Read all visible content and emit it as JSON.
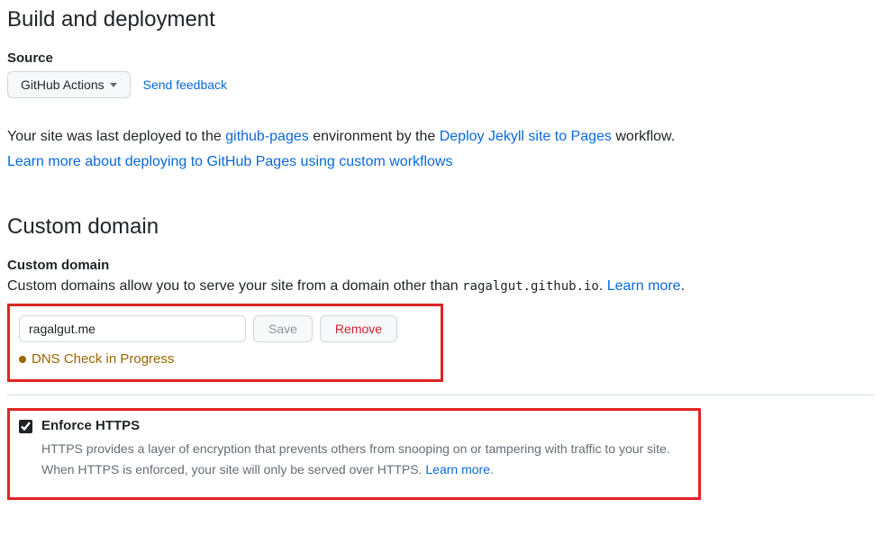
{
  "build": {
    "title": "Build and deployment",
    "source_label": "Source",
    "source_dropdown": "GitHub Actions",
    "send_feedback": "Send feedback",
    "deployed_prefix": "Your site was last deployed to the ",
    "deployed_env": "github-pages",
    "deployed_mid": " environment by the ",
    "deployed_workflow": "Deploy Jekyll site to Pages",
    "deployed_suffix": " workflow.",
    "learn_more_workflows": "Learn more about deploying to GitHub Pages using custom workflows"
  },
  "custom_domain": {
    "title": "Custom domain",
    "subhead": "Custom domain",
    "desc_prefix": "Custom domains allow you to serve your site from a domain other than ",
    "desc_domain": "ragalgut.github.io",
    "desc_suffix": ". ",
    "learn_more": "Learn more",
    "input_value": "ragalgut.me",
    "save_label": "Save",
    "remove_label": "Remove",
    "status_text": "DNS Check in Progress"
  },
  "enforce": {
    "label": "Enforce HTTPS",
    "desc1": "HTTPS provides a layer of encryption that prevents others from snooping on or tampering with traffic to your site.",
    "desc2_prefix": "When HTTPS is enforced, your site will only be served over HTTPS. ",
    "learn_more": "Learn more",
    "checked": true
  }
}
